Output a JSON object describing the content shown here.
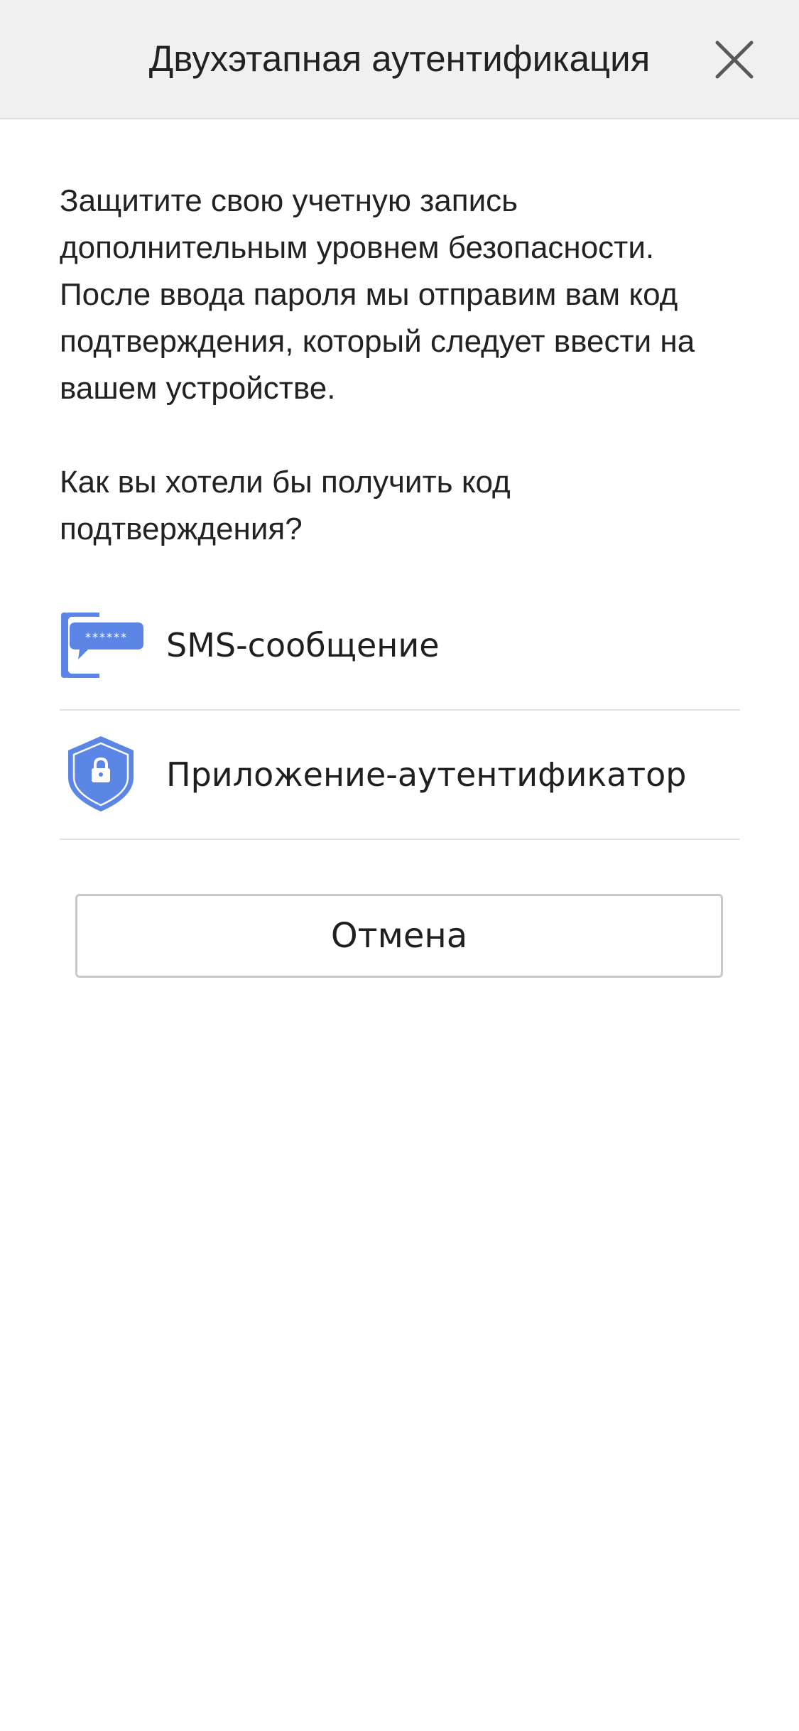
{
  "header": {
    "title": "Двухэтапная аутентификация",
    "close_icon": "close-icon"
  },
  "body": {
    "intro": "Защитите свою учетную запись дополнительным уровнем безопасности. После ввода пароля мы отправим вам код подтверждения, который следует ввести на вашем устройстве.",
    "question": "Как вы хотели бы получить код подтверждения?"
  },
  "options": [
    {
      "label": "SMS-сообщение",
      "icon": "sms-phone-icon"
    },
    {
      "label": "Приложение-аутентификатор",
      "icon": "shield-lock-icon"
    }
  ],
  "cancel_label": "Отмена",
  "colors": {
    "accent": "#5b86e5",
    "header_bg": "#f0f0f0",
    "divider": "#e1e1e1",
    "text": "#1f1f1f"
  }
}
